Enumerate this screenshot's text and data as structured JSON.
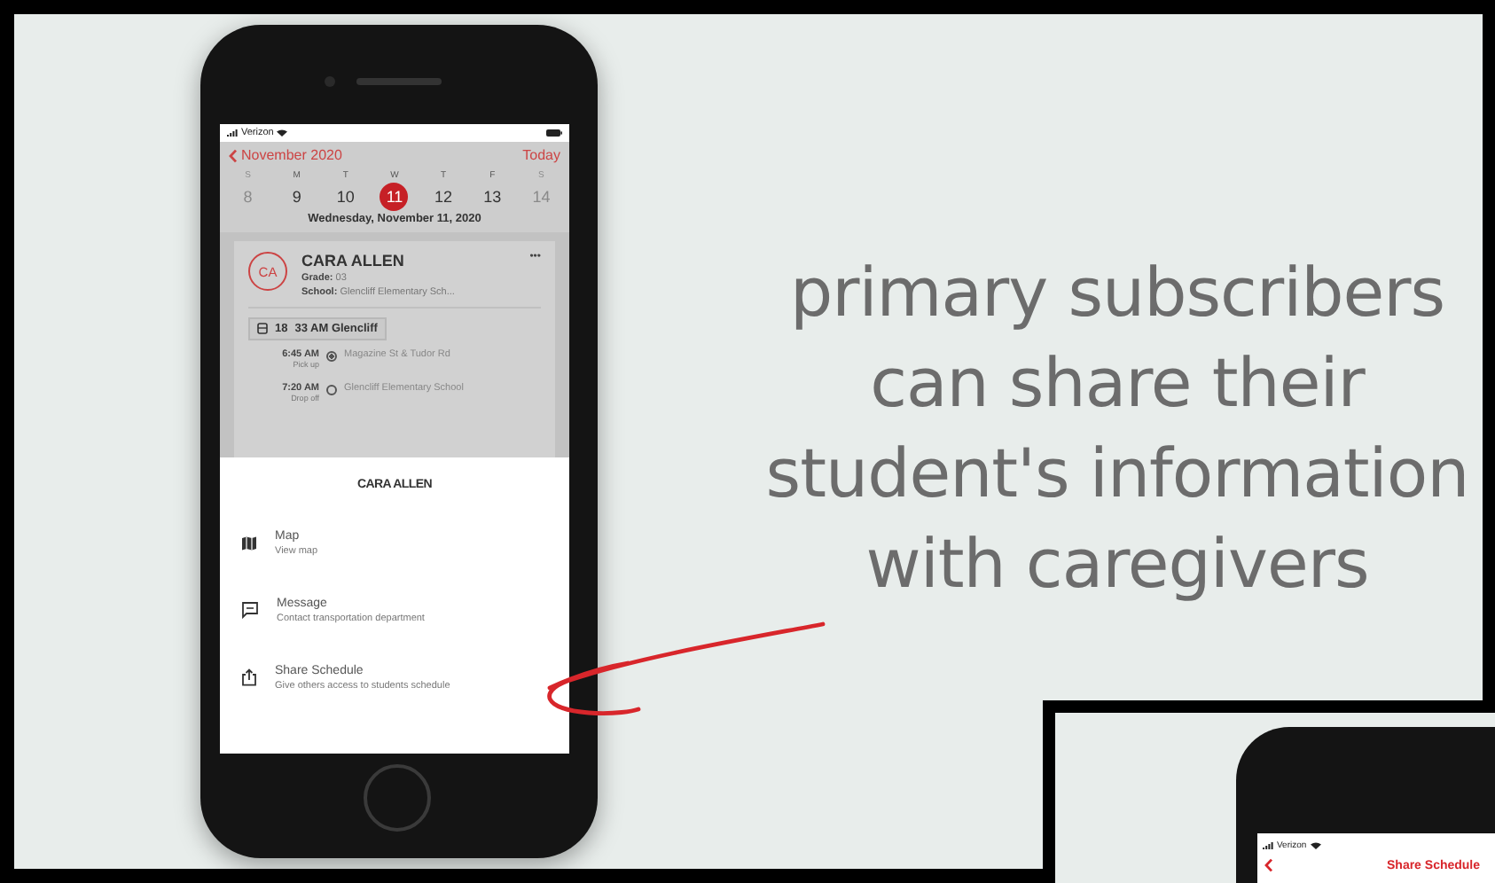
{
  "phone": {
    "status_bar": {
      "carrier": "Verizon"
    },
    "header": {
      "month": "November 2020",
      "today": "Today"
    },
    "week": [
      {
        "day": "S",
        "date": "8",
        "selected": false,
        "dimmed": true
      },
      {
        "day": "M",
        "date": "9",
        "selected": false,
        "dimmed": false
      },
      {
        "day": "T",
        "date": "10",
        "selected": false,
        "dimmed": false
      },
      {
        "day": "W",
        "date": "11",
        "selected": true,
        "dimmed": false
      },
      {
        "day": "T",
        "date": "12",
        "selected": false,
        "dimmed": false
      },
      {
        "day": "F",
        "date": "13",
        "selected": false,
        "dimmed": false
      },
      {
        "day": "S",
        "date": "14",
        "selected": false,
        "dimmed": true
      }
    ],
    "date_title": "Wednesday, November 11, 2020",
    "card": {
      "initials": "CA",
      "name": "CARA ALLEN",
      "more": "•••",
      "grade_label": "Grade:",
      "grade": "03",
      "school_label": "School:",
      "school": "Glencliff Elementary Sch...",
      "route_number": "18",
      "route_name": "33 AM Glencliff",
      "stops": [
        {
          "time": "6:45 AM",
          "note": "Pick up",
          "place": "Magazine St & Tudor Rd",
          "reached": true
        },
        {
          "time": "7:20 AM",
          "note": "Drop off",
          "place": "Glencliff Elementary School",
          "reached": false
        }
      ]
    },
    "sheet": {
      "title": "CARA ALLEN",
      "actions": [
        {
          "kind": "map",
          "title": "Map",
          "subtitle": "View map"
        },
        {
          "kind": "message",
          "title": "Message",
          "subtitle": "Contact transportation department"
        },
        {
          "kind": "share",
          "title": "Share Schedule",
          "subtitle": "Give others access to students schedule"
        }
      ]
    }
  },
  "caption": [
    "primary subscribers",
    "can share their",
    "student's information",
    "with caregivers"
  ],
  "inset": {
    "carrier": "Verizon",
    "title": "Share Schedule"
  }
}
